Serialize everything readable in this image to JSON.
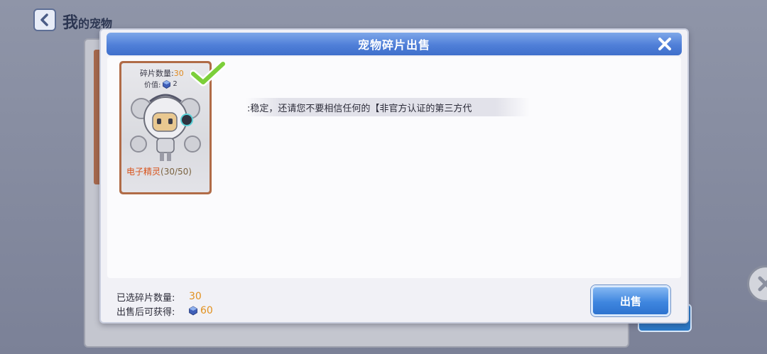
{
  "background": {
    "title_main": "我",
    "title_sub": "的宠物"
  },
  "modal": {
    "title": "宠物碎片出售"
  },
  "pet_card": {
    "count_label": "碎片数量:",
    "count_value": "30",
    "value_label": "价值:",
    "value_amount": "2",
    "name": "电子精灵",
    "quantity": "(30/50)",
    "selected": true
  },
  "notice": {
    "text": ":稳定，还请您不要相信任何的【非官方认证的第三方代"
  },
  "summary": {
    "selected_label": "已选碎片数量:",
    "selected_value": "30",
    "earn_label": "出售后可获得:",
    "earn_value": "60"
  },
  "actions": {
    "sell_label": "出售"
  },
  "colors": {
    "header_blue": "#4f7fd8",
    "accent_orange": "#e2911f",
    "card_border": "#b06b47",
    "check_green": "#7ccf3a"
  }
}
